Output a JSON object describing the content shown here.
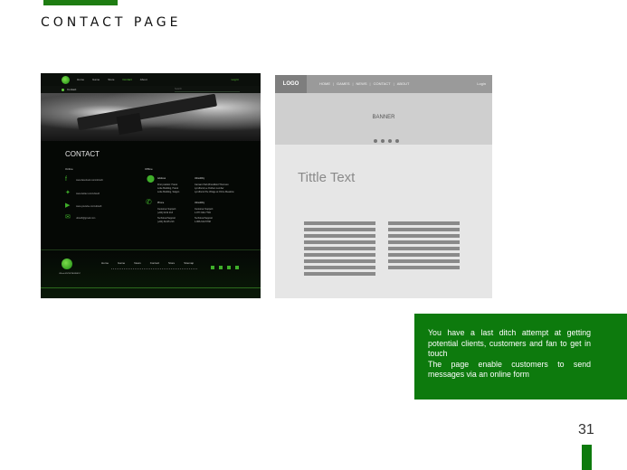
{
  "page": {
    "title": "CONTACT PAGE",
    "number": "31",
    "accent_color": "#0d7a0d"
  },
  "dark_mockup": {
    "nav": [
      "Home",
      "Game",
      "Store",
      "Contact",
      "About"
    ],
    "login": "Log In",
    "breadcrumb": "Contact",
    "search_placeholder": "Search",
    "heading": "CONTACT",
    "online_heading": "Online",
    "offline_heading": "Offline",
    "online": [
      {
        "icon": "facebook-icon",
        "text": "www.facebook.com/ubisoft"
      },
      {
        "icon": "twitter-icon",
        "text": "www.twitter.com/ubisoft"
      },
      {
        "icon": "youtube-icon",
        "text": "www.youtube.com/ubisoft"
      },
      {
        "icon": "mail-icon",
        "text": "ubisoft@gmail.com"
      }
    ],
    "offline": {
      "address_label": "Address",
      "address_lines": [
        "First position: Hanoi",
        "Lotte Building, Hanoi",
        "Lotte Building, Saigon"
      ],
      "address_label_2": "Ubisofthty",
      "address_lines_2": [
        "Camaro Park,Brookfield Thomson",
        "Lyndhurst,Le Oothen Lumber",
        "Lyndhurst Pte Village at Ozzie Meadow"
      ],
      "phone_label": "Phone",
      "phone_lines": [
        "Customer Support",
        "(+84) 0212 213",
        "Technical Support",
        "(+84) 31215 213"
      ],
      "phone_label_2": "Ubisofthty",
      "phone_lines_2": [
        "Customer Support",
        "1-877-632-7749",
        "Technical Support",
        "1-866-610-5738"
      ]
    },
    "footer_nav": [
      "Home",
      "Game",
      "News",
      "Contact",
      "Store",
      "Sitemap"
    ],
    "footer_logo_text": "UBIsoft ENTERTAINMENT"
  },
  "wireframe": {
    "logo": "LOGO",
    "nav": [
      "HOME",
      "GAMES",
      "NEWS",
      "CONTACT",
      "ABOUT"
    ],
    "separator": "|",
    "login": "Login",
    "banner": "BANNER",
    "title": "Tittle Text"
  },
  "info_box": {
    "line1": "You have a last ditch attempt at getting potential clients, customers and fan to get in touch",
    "line2": "The page enable customers to send messages via an online form"
  }
}
